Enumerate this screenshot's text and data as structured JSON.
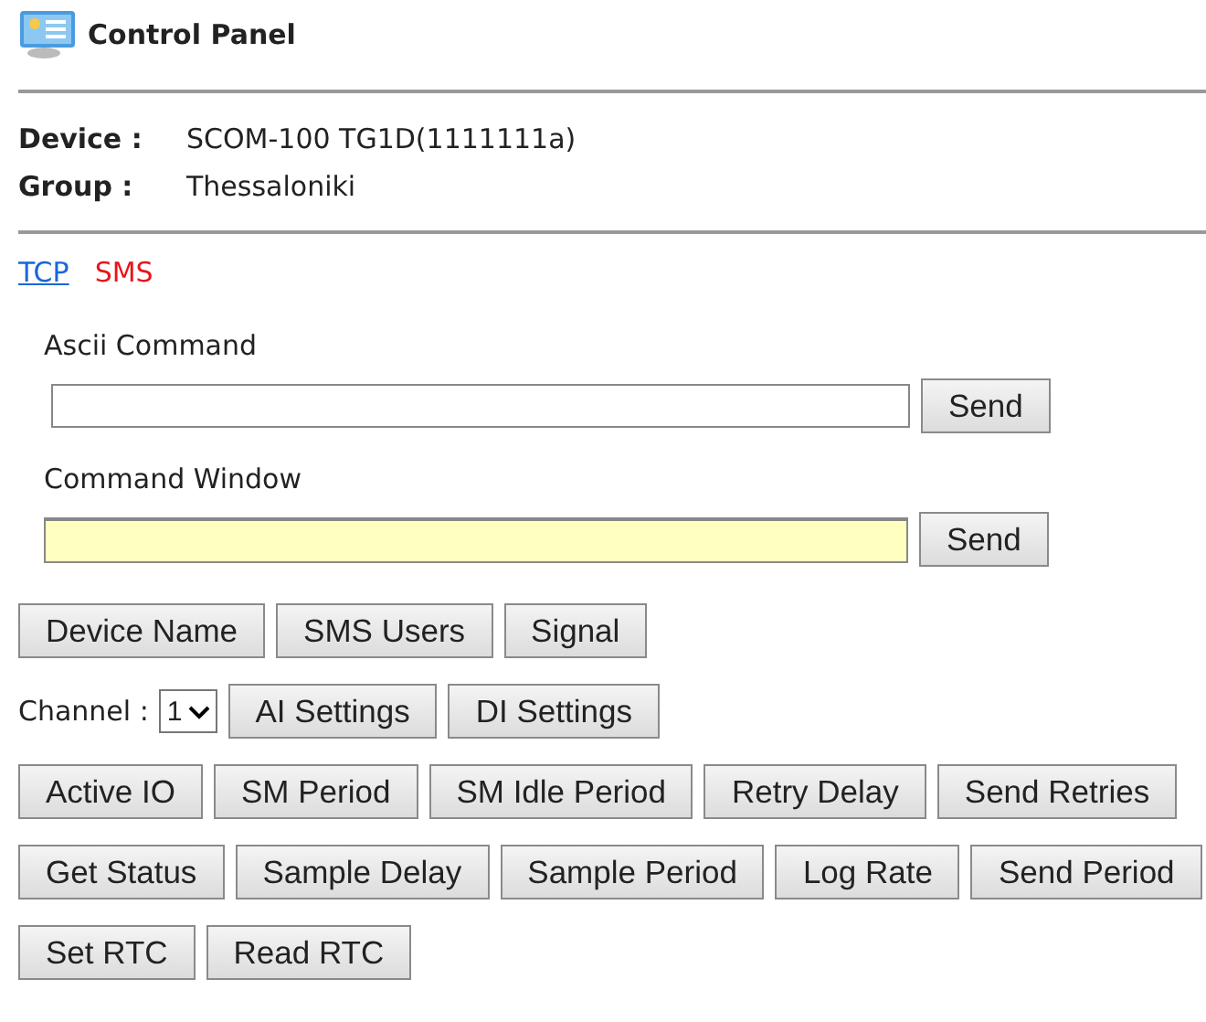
{
  "header": {
    "title": "Control Panel"
  },
  "info": [
    {
      "label": "Device :",
      "value": "SCOM-100 TG1D(1111111a)"
    },
    {
      "label": "Group :",
      "value": "Thessaloniki"
    }
  ],
  "tabs": [
    {
      "label": "TCP",
      "selected": false
    },
    {
      "label": "SMS",
      "selected": true
    }
  ],
  "commands": [
    {
      "label": "Ascii Command",
      "kind": "plain",
      "button": "Send"
    },
    {
      "label": "Command Window",
      "kind": "highlighted",
      "button": "Send"
    }
  ],
  "button_rows": [
    {
      "buttons": [
        "Device Name",
        "SMS Users",
        "Signal"
      ]
    },
    {
      "label": "Channel :",
      "select": "1",
      "buttons": [
        "AI Settings",
        "DI Settings"
      ]
    },
    {
      "buttons": [
        "Active IO",
        "SM Period",
        "SM Idle Period",
        "Retry Delay",
        "Send Retries"
      ]
    },
    {
      "buttons": [
        "Get Status",
        "Sample Delay",
        "Sample Period",
        "Log Rate",
        "Send Period"
      ]
    },
    {
      "buttons": [
        "Set RTC",
        "Read RTC"
      ]
    }
  ]
}
